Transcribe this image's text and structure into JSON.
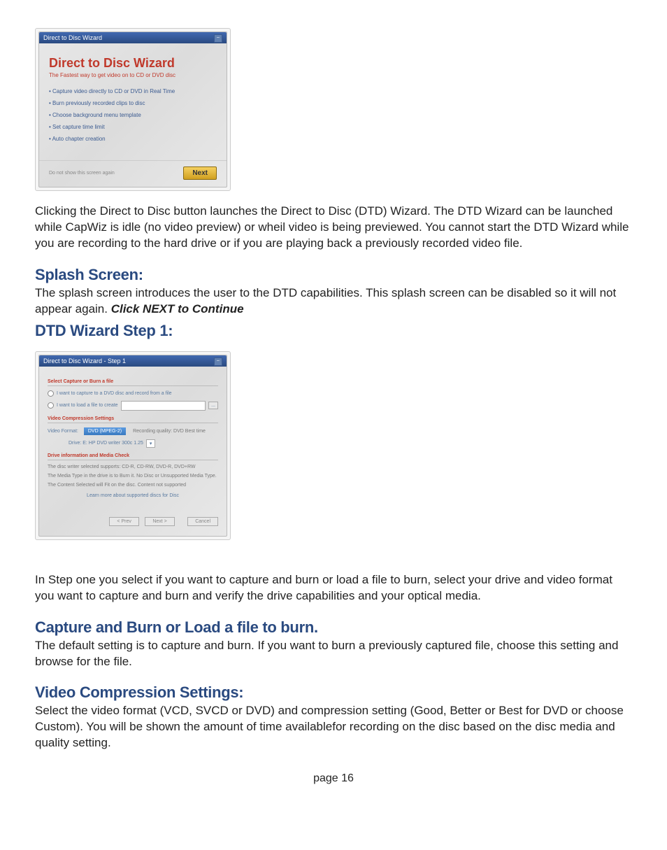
{
  "splash": {
    "titlebar": "Direct to Disc Wizard",
    "heading": "Direct to Disc Wizard",
    "sub": "The Fastest way to get video on to CD or DVD disc",
    "bullets": [
      "• Capture video directly to CD or DVD in Real Time",
      "• Burn previously recorded clips to disc",
      "• Choose background menu template",
      "• Set capture time limit",
      "• Auto chapter creation"
    ],
    "checkbox": "Do not show this screen again",
    "next": "Next"
  },
  "body": {
    "p1": "Clicking  the Direct to Disc button launches the Direct to Disc (DTD) Wizard. The DTD Wizard can be launched while CapWiz is idle (no video preview) or wheil video is being  previewed. You cannot start the DTD Wizard while you are recording to the hard drive or if you are playing back a previously recorded video file.",
    "h1": "Splash Screen:",
    "p2a": "The splash screen introduces the user to the DTD capabilities.  This splash screen can be disabled so it will not appear again.  ",
    "p2b": "Click NEXT to Continue",
    "h2": "DTD Wizard Step 1:",
    "p3": "In Step one you select if you want to capture and burn or load a file to burn, select your drive and video format you want to capture and burn and verify the drive capabilities and your optical media.",
    "h3": "Capture and Burn or Load a file to burn.",
    "p4": "The default setting is to capture and burn. If you want to burn a previously captured file, choose this setting and browse for the file.",
    "h4": "Video Compression Settings:",
    "p5": "Select the video format (VCD, SVCD or DVD) and compression setting (Good, Better or Best for DVD or choose Custom). You will be shown the amount of time availablefor recording on the disc based on the disc media and quality setting.",
    "pagenum": "page 16"
  },
  "step1": {
    "titlebar": "Direct to Disc Wizard - Step 1",
    "sec1": "Select Capture or Burn a file",
    "r1": "I want to capture to a DVD disc and record from a file",
    "r2": "I want to load a file to create",
    "browse": "...",
    "sec2": "Video Compression Settings",
    "fmt_label": "Video Format:",
    "fmt_value": "DVD (MPEG-2)",
    "rec_label": "Recording quality: DVD Best time",
    "drive_row": "Drive:  E:  HP DVD writer 300c 1.25",
    "sec3": "Drive information and Media Check",
    "info1": "The disc writer selected supports:   CD-R, CD-RW, DVD-R, DVD+RW",
    "info2": "The Media Type in the drive is to Burn it.  No Disc or Unsupported Media Type.",
    "info3": "The Content Selected will Fit on the disc.  Content not supported",
    "link": "Learn more about supported discs for Disc",
    "btn_prev": "< Prev",
    "btn_next": "Next >",
    "btn_cancel": "Cancel"
  }
}
